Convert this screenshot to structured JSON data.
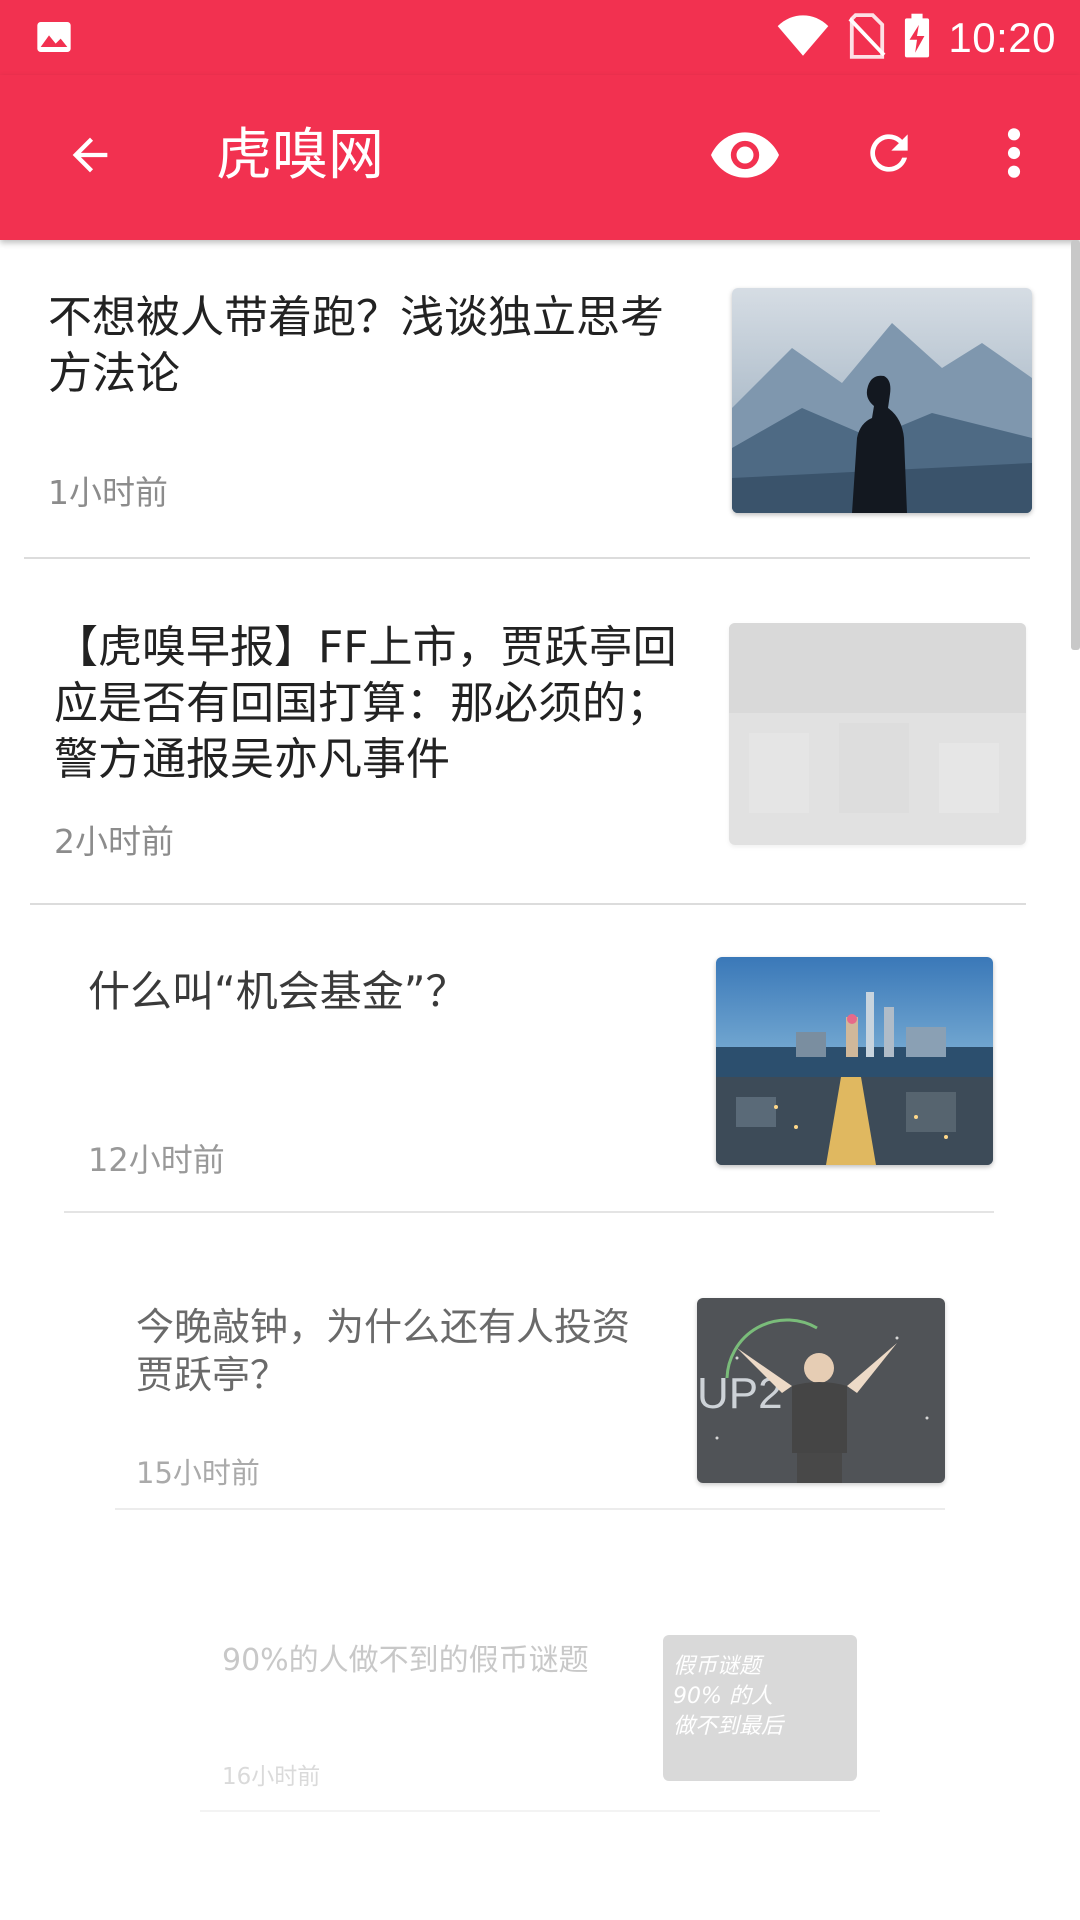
{
  "status_bar": {
    "time": "10:20"
  },
  "app_bar": {
    "title": "虎嗅网"
  },
  "feed": [
    {
      "title": "不想被人带着跑？浅谈独立思考方法论",
      "time": "1小时前"
    },
    {
      "title": "【虎嗅早报】FF上市，贾跃亭回应是否有回国打算：那必须的；警方通报吴亦凡事件",
      "time": "2小时前"
    },
    {
      "title": "什么叫“机会基金”？",
      "time": "12小时前"
    },
    {
      "title": "今晚敲钟，为什么还有人投资贾跃亭？",
      "time": "15小时前"
    },
    {
      "title": "90%的人做不到的假币谜题",
      "time": "16小时前",
      "thumb_text": [
        "假币谜题",
        "90% 的人",
        "做不到最后"
      ]
    }
  ],
  "colors": {
    "accent": "#f23150"
  }
}
